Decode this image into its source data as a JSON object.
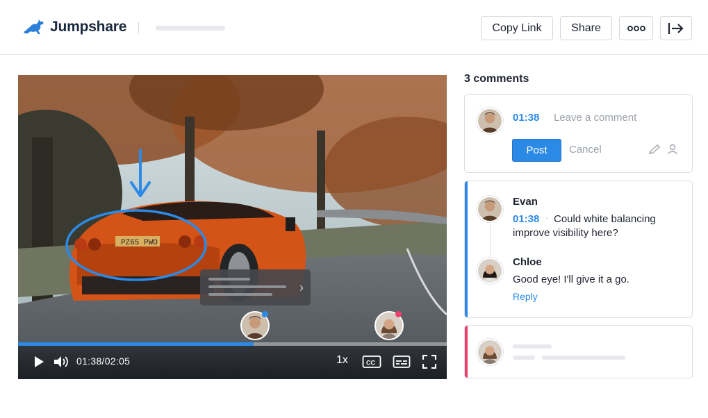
{
  "header": {
    "brand": "Jumpshare",
    "buttons": {
      "copy_link": "Copy Link",
      "share": "Share"
    },
    "icons": {
      "more": "more-horizontal-icon",
      "exit": "exit-arrow-icon"
    }
  },
  "player": {
    "time_display": "01:38/02:05",
    "progress": 0.55,
    "speed": "1x",
    "icons": [
      "play-icon",
      "volume-icon",
      "cc-icon",
      "subtitles-icon",
      "fullscreen-icon"
    ]
  },
  "comments": {
    "count_label": "3 comments",
    "composer": {
      "timestamp": "01:38",
      "placeholder": "Leave a comment",
      "post_label": "Post",
      "cancel_label": "Cancel"
    },
    "thread": {
      "author": "Evan",
      "timestamp": "01:38",
      "text_line1": "Could white balancing",
      "text_line2": "improve visibility here?",
      "reply_author": "Chloe",
      "reply_text": "Good eye! I'll give it a go.",
      "reply_label": "Reply"
    }
  },
  "colors": {
    "accent_blue": "#2b8ae6",
    "accent_pink": "#e8406a",
    "text_dark": "#1f2430",
    "muted": "#9aa0a8"
  }
}
